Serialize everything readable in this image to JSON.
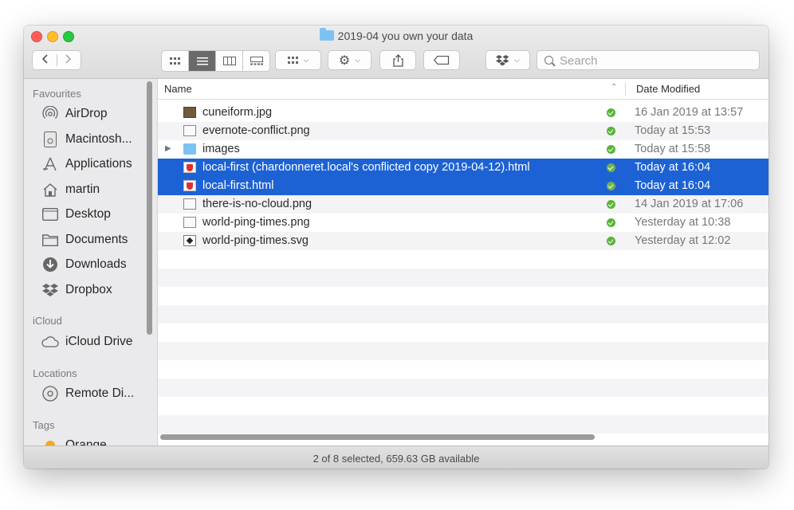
{
  "window": {
    "title": "2019-04 you own your data"
  },
  "toolbar": {
    "search_placeholder": "Search"
  },
  "sidebar": {
    "sections": [
      {
        "label": "Favourites"
      },
      {
        "label": "iCloud"
      },
      {
        "label": "Locations"
      },
      {
        "label": "Tags"
      }
    ],
    "favourites": [
      {
        "label": "AirDrop",
        "icon": "airdrop-icon"
      },
      {
        "label": "Macintosh...",
        "icon": "hard-drive-icon"
      },
      {
        "label": "Applications",
        "icon": "applications-icon"
      },
      {
        "label": "martin",
        "icon": "home-icon"
      },
      {
        "label": "Desktop",
        "icon": "desktop-icon"
      },
      {
        "label": "Documents",
        "icon": "documents-icon"
      },
      {
        "label": "Downloads",
        "icon": "downloads-icon"
      },
      {
        "label": "Dropbox",
        "icon": "dropbox-icon"
      }
    ],
    "icloud": [
      {
        "label": "iCloud Drive",
        "icon": "cloud-icon"
      }
    ],
    "locations": [
      {
        "label": "Remote Di...",
        "icon": "disc-icon"
      }
    ],
    "tags": [
      {
        "label": "Orange",
        "color": "#f5a623"
      }
    ]
  },
  "list": {
    "columns": {
      "name": "Name",
      "date": "Date Modified"
    },
    "rows": [
      {
        "name": "cuneiform.jpg",
        "date": "16 Jan 2019 at 13:57",
        "type": "image",
        "selected": false
      },
      {
        "name": "evernote-conflict.png",
        "date": "Today at 15:53",
        "type": "png",
        "selected": false
      },
      {
        "name": "images",
        "date": "Today at 15:58",
        "type": "folder",
        "selected": false
      },
      {
        "name": "local-first (chardonneret.local's conflicted copy 2019-04-12).html",
        "date": "Today at 16:04",
        "type": "html",
        "selected": true
      },
      {
        "name": "local-first.html",
        "date": "Today at 16:04",
        "type": "html",
        "selected": true
      },
      {
        "name": "there-is-no-cloud.png",
        "date": "14 Jan 2019 at 17:06",
        "type": "png",
        "selected": false
      },
      {
        "name": "world-ping-times.png",
        "date": "Yesterday at 10:38",
        "type": "png",
        "selected": false
      },
      {
        "name": "world-ping-times.svg",
        "date": "Yesterday at 12:02",
        "type": "svg",
        "selected": false
      }
    ]
  },
  "status": {
    "text": "2 of 8 selected, 659.63 GB available"
  },
  "colors": {
    "selection": "#1d62d4",
    "sync_ok": "#5ab338"
  }
}
